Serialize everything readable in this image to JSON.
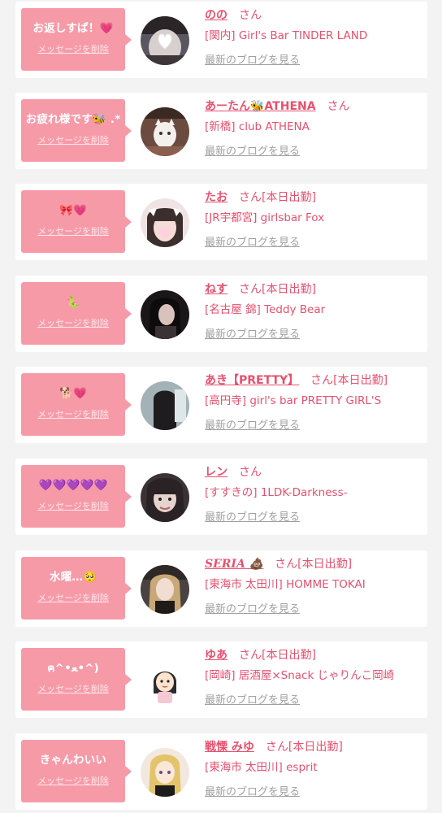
{
  "delete_label": "メッセージを削除",
  "blog_label": "最新のブログを見る",
  "san_label": "さん",
  "colors": {
    "accent": "#e8506e",
    "bubble": "#f79aa8",
    "card": "#ffffff",
    "background": "#f3f3f3",
    "link_gray": "#a0a0a0"
  },
  "items": [
    {
      "message": "お返しすぱ！💗",
      "name": "のの",
      "status": "",
      "store": "[関内] Girl's Bar TINDER LAND"
    },
    {
      "message": "お疲れ様です🐝 .*",
      "name": "あーたん🐝ATHENA",
      "status": "",
      "store": "[新橋] club ATHENA"
    },
    {
      "message": "🎀💗",
      "name": "たお",
      "status": "[本日出勤]",
      "store": "[JR宇都宮] girlsbar Fox"
    },
    {
      "message": "🐍",
      "name": "ねす",
      "status": "[本日出勤]",
      "store": "[名古屋 錦] Teddy Bear"
    },
    {
      "message": "🐕💗",
      "name": "あき【PRETTY】",
      "status": "[本日出勤]",
      "store": "[高円寺] girl's bar PRETTY GIRL'S"
    },
    {
      "message": "💜💜💜💜💜",
      "name": "レン",
      "status": "",
      "store": "[すすきの] 1LDK-Darkness-"
    },
    {
      "message": "水曜…🥺",
      "name": "SERIA 💩",
      "status": "[本日出勤]",
      "store": "[東海市 太田川] HOMME TOKAI"
    },
    {
      "message": "ฅ^•ﻌ•^)",
      "name": "ゆあ",
      "status": "[本日出勤]",
      "store": "[岡崎] 居酒屋×Snack じゃりんこ岡崎"
    },
    {
      "message": "きゃんわいい",
      "name": "戦慄 みゆ",
      "status": "[本日出勤]",
      "store": "[東海市 太田川] esprit"
    }
  ]
}
